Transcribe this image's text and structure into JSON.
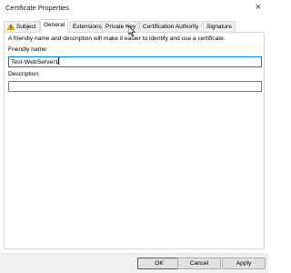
{
  "window": {
    "title": "Certificate Properties",
    "close_glyph": "×"
  },
  "tabs": [
    {
      "label": "Subject",
      "icon": "warning-icon"
    },
    {
      "label": "General"
    },
    {
      "label": "Extensions"
    },
    {
      "label": "Private Key"
    },
    {
      "label": "Certification Authority"
    },
    {
      "label": "Signature"
    }
  ],
  "general": {
    "description_text": "A friendly name and description will make it easier to identify and use a certificate.",
    "friendly_name_label": "Friendly name:",
    "friendly_name_value": "Test-WebServer1",
    "description_label": "Description:",
    "description_value": ""
  },
  "buttons": {
    "ok": "OK",
    "cancel": "Cancel",
    "apply": "Apply"
  },
  "colors": {
    "accent": "#0078d7",
    "warning": "#f3c300"
  }
}
